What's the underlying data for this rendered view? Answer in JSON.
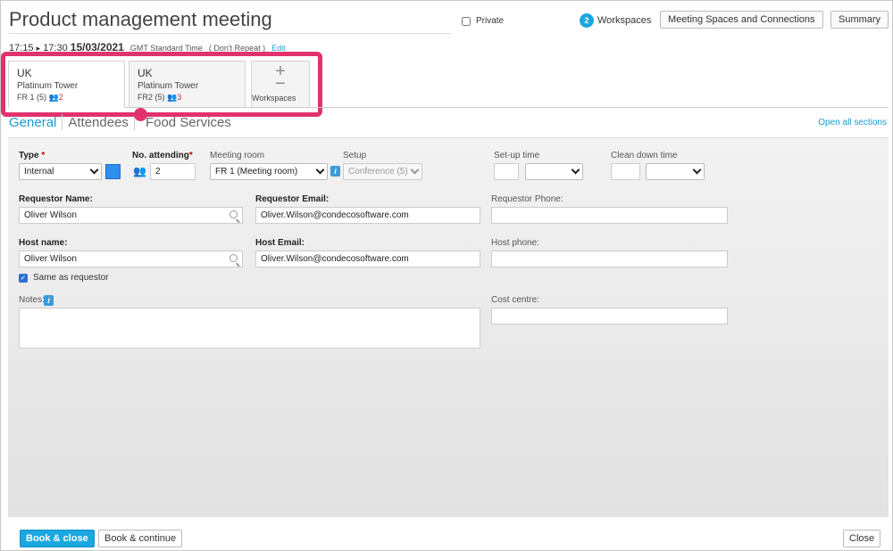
{
  "header": {
    "title": "Product management meeting",
    "time_start": "17:15",
    "time_arrow": "▸",
    "time_end": "17:30",
    "date": "15/03/2021",
    "timezone": "GMT Standard Time",
    "repeat": "( Don't Repeat )",
    "edit_label": "Edit",
    "private_label": "Private",
    "workspace_count": "2",
    "workspaces_label": "Workspaces",
    "spaces_button": "Meeting Spaces and Connections",
    "summary_button": "Summary"
  },
  "workspaces": [
    {
      "country": "UK",
      "building": "Platinum Tower",
      "floor": "FR 1",
      "capacity": "(5)",
      "attendees": "2"
    },
    {
      "country": "UK",
      "building": "Platinum Tower",
      "floor": "FR2",
      "capacity": "(5)",
      "attendees": "3"
    }
  ],
  "add_workspace": {
    "plus": "+",
    "minus": "−",
    "label": "Workspaces"
  },
  "tabs": [
    {
      "label": "General"
    },
    {
      "label": "Attendees"
    },
    {
      "label": "Food Services"
    }
  ],
  "open_all_label": "Open all sections",
  "form": {
    "type_label": "Type",
    "required_mark": "*",
    "type_value": "Internal",
    "attending_label": "No. attending",
    "attending_value": "2",
    "room_label": "Meeting room",
    "room_value": "FR 1 (Meeting room)",
    "setup_label": "Setup",
    "setup_value": "Conference (5)",
    "setup_time_label": "Set-up time",
    "clean_time_label": "Clean down time",
    "requestor_name_label": "Requestor Name:",
    "requestor_name_value": "Oliver Wilson",
    "requestor_email_label": "Requestor Email:",
    "requestor_email_value": "Oliver.Wilson@condecosoftware.com",
    "requestor_phone_label": "Requestor Phone:",
    "host_name_label": "Host name:",
    "host_name_value": "Oliver Wilson",
    "host_email_label": "Host Email:",
    "host_email_value": "Oliver.Wilson@condecosoftware.com",
    "host_phone_label": "Host phone:",
    "same_as_requestor_label": "Same as requestor",
    "notes_label": "Notes:",
    "cost_centre_label": "Cost centre:",
    "info_glyph": "i",
    "check_glyph": "✓"
  },
  "footer": {
    "book_close": "Book & close",
    "book_continue": "Book & continue",
    "close": "Close"
  },
  "colors": {
    "accent": "#1ba7e0",
    "highlight": "#e0336e",
    "type_swatch": "#2f8fef"
  }
}
